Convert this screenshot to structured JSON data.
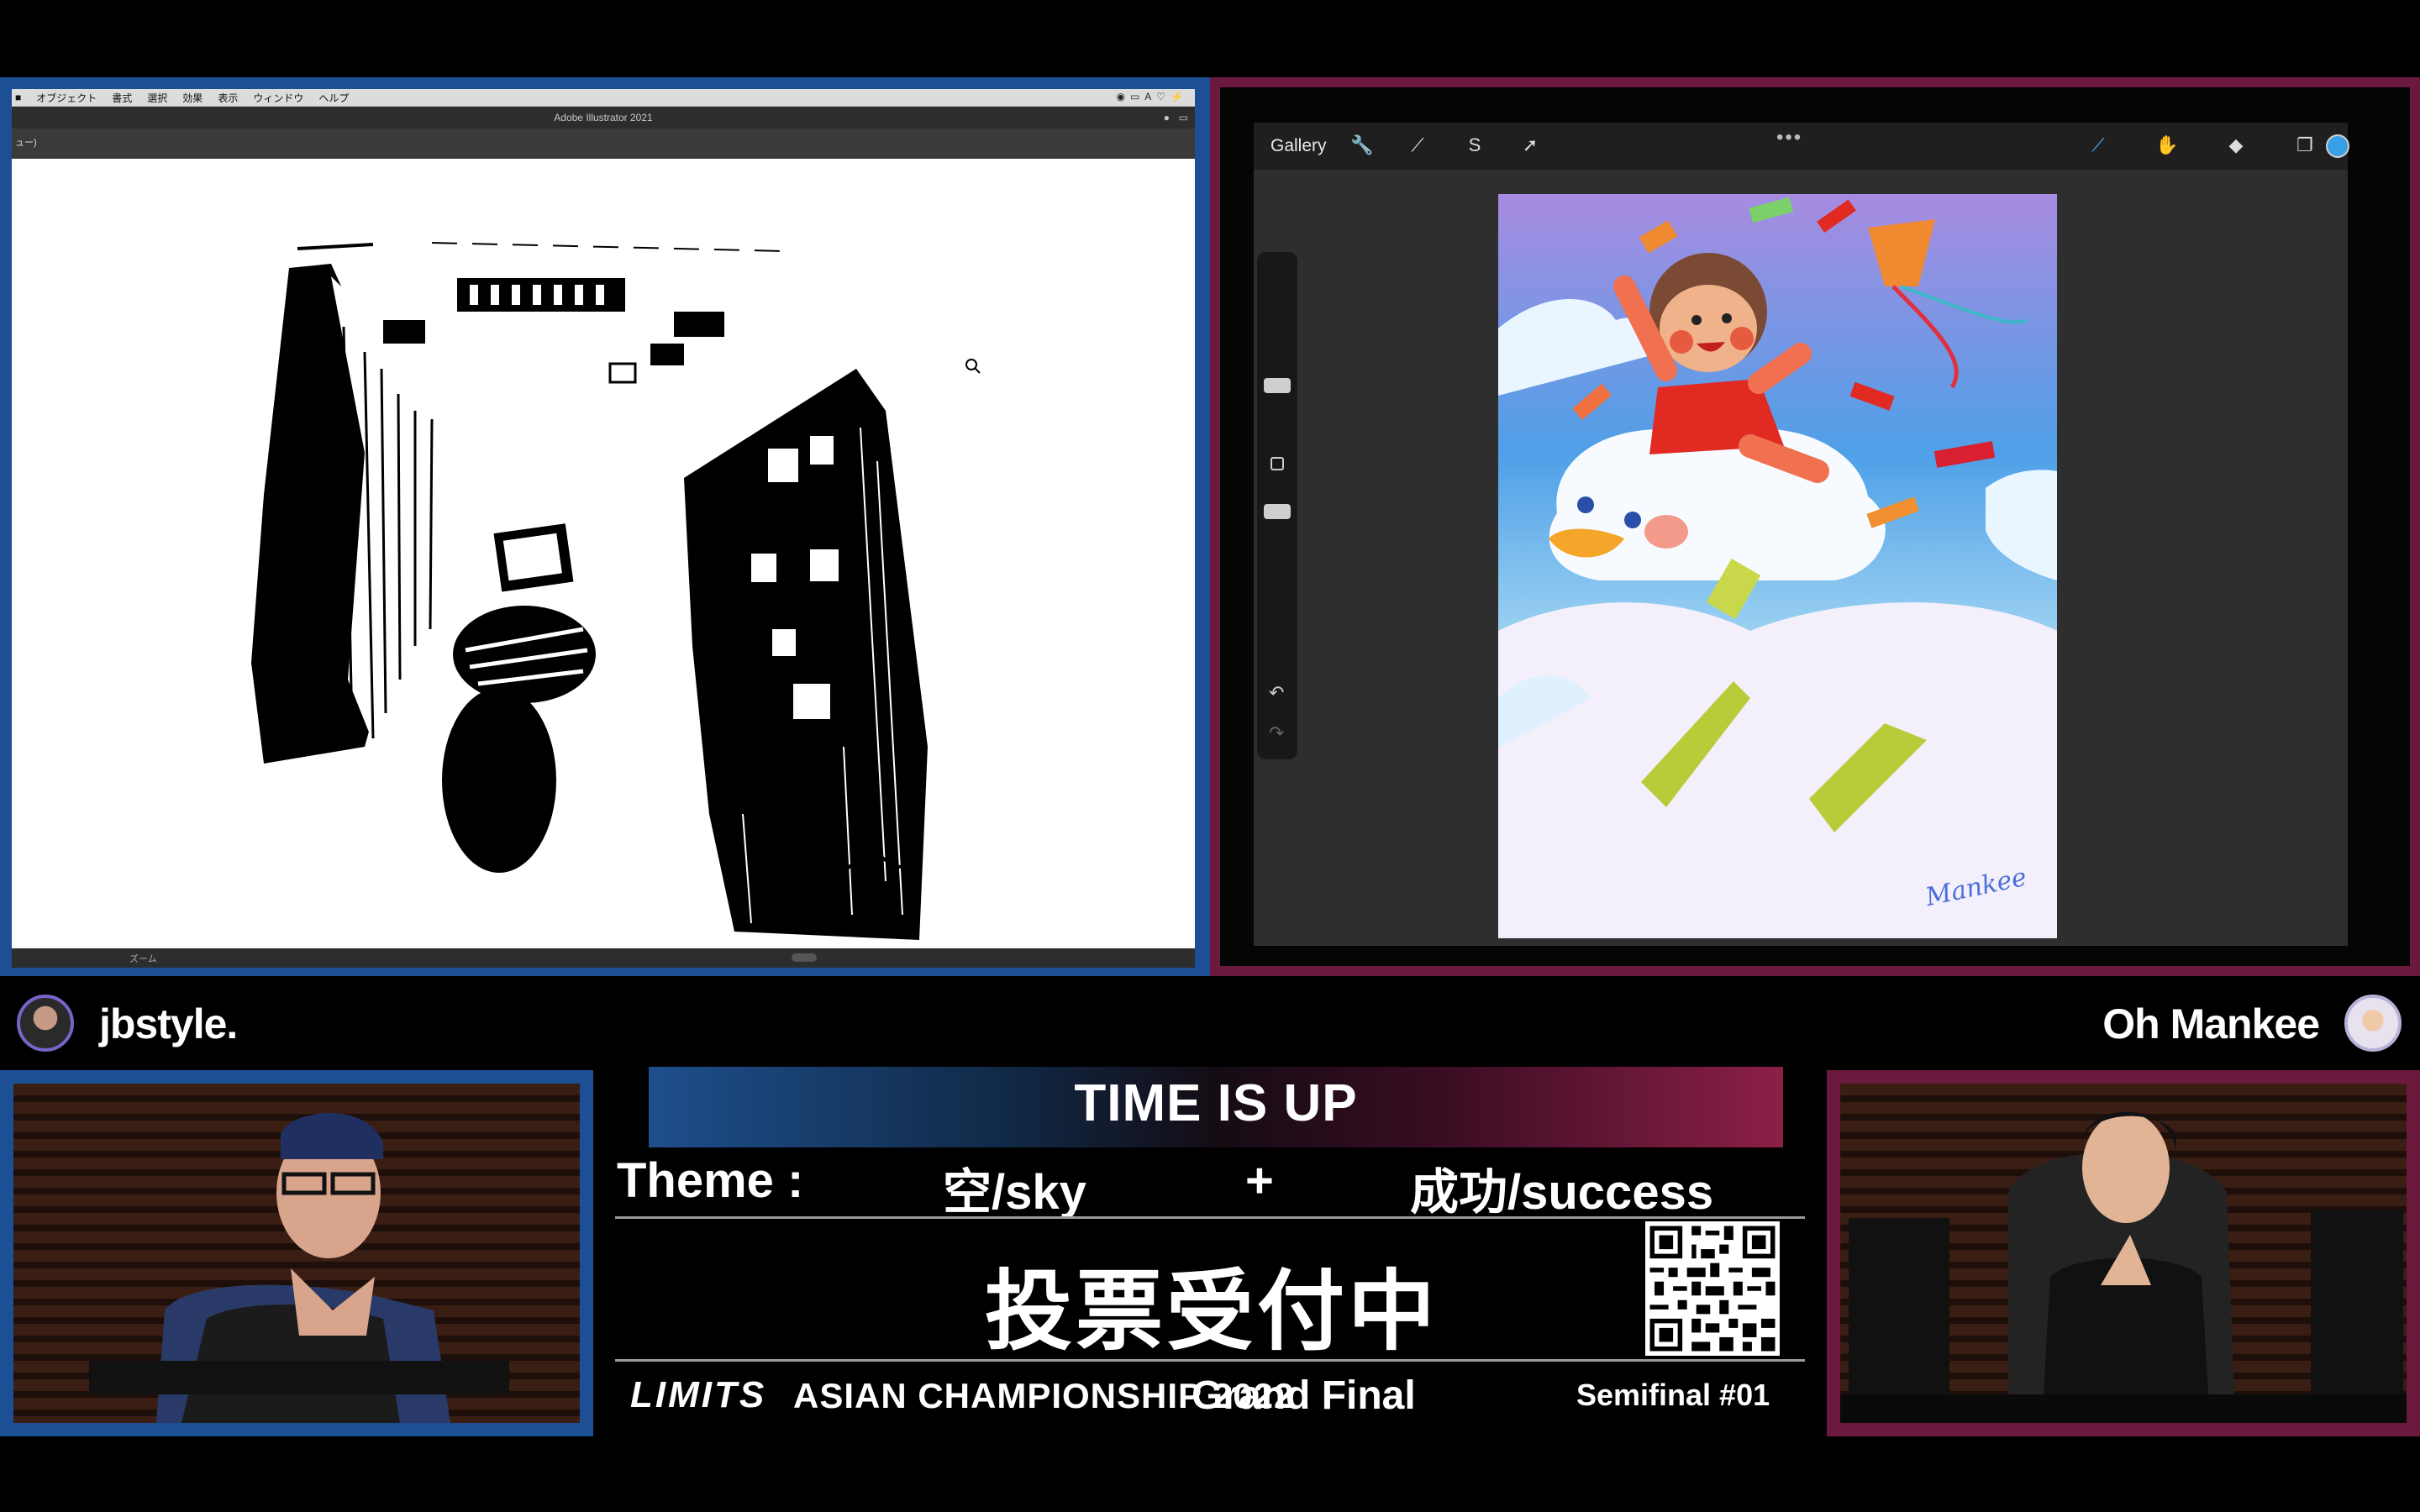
{
  "left_screen": {
    "app_menu": [
      "オブジェクト",
      "書式",
      "選択",
      "効果",
      "表示",
      "ウィンドウ",
      "ヘルプ"
    ],
    "window_title": "Adobe Illustrator 2021",
    "tab_label": "ュー)",
    "status_zoom": "ズーム"
  },
  "right_screen": {
    "gallery_label": "Gallery",
    "active_color": "#3aa0e6",
    "tools": [
      "wrench-icon",
      "magic-wand-icon",
      "selection-icon",
      "transform-icon",
      "brush-icon",
      "smudge-icon",
      "eraser-icon",
      "layers-icon"
    ]
  },
  "players": {
    "left": {
      "name": "jbstyle.",
      "accent": "#1d4f94"
    },
    "right": {
      "name": "Oh Mankee",
      "accent": "#6b1a3e"
    }
  },
  "banner": {
    "text": "TIME IS UP"
  },
  "theme": {
    "label": "Theme :",
    "word_a": "空/sky",
    "plus": "+",
    "word_b": "成功/success"
  },
  "voting": {
    "text": "投票受付中"
  },
  "footer": {
    "logo": "LIMITS",
    "event": "ASIAN CHAMPIONSHIP 2022",
    "stage": "Grand Final",
    "round": "Semifinal #01"
  }
}
